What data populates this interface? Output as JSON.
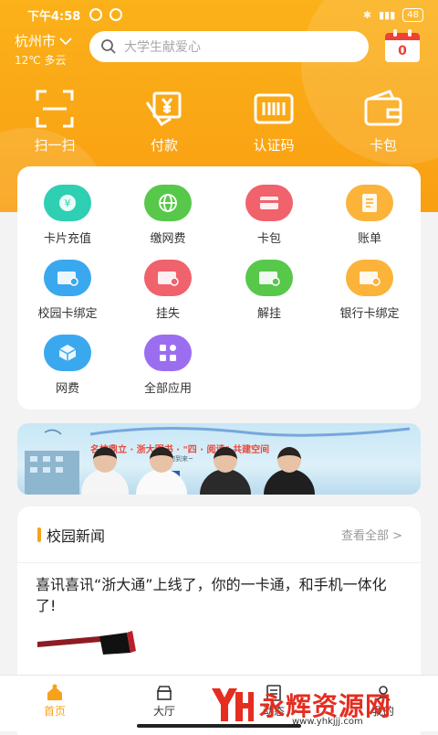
{
  "status": {
    "time": "下午4:58",
    "battery": "48"
  },
  "location": {
    "city": "杭州市",
    "weather": "12℃ 多云"
  },
  "search": {
    "placeholder": "大学生献爱心"
  },
  "calendar": {
    "value": "0"
  },
  "quick_actions": [
    {
      "label": "扫一扫",
      "icon": "scan-icon"
    },
    {
      "label": "付款",
      "icon": "payment-icon"
    },
    {
      "label": "认证码",
      "icon": "barcode-icon"
    },
    {
      "label": "卡包",
      "icon": "wallet-icon"
    }
  ],
  "apps": [
    {
      "label": "卡片充值",
      "icon": "card-recharge-icon",
      "color": "#2ecfb2"
    },
    {
      "label": "缴网费",
      "icon": "globe-icon",
      "color": "#57c84a"
    },
    {
      "label": "卡包",
      "icon": "card-wallet-icon",
      "color": "#f0626c"
    },
    {
      "label": "账单",
      "icon": "bill-icon",
      "color": "#fbb33a"
    },
    {
      "label": "校园卡绑定",
      "icon": "campus-card-bind-icon",
      "color": "#3aa8ef"
    },
    {
      "label": "挂失",
      "icon": "report-loss-icon",
      "color": "#f0626c"
    },
    {
      "label": "解挂",
      "icon": "unfreeze-icon",
      "color": "#57c84a"
    },
    {
      "label": "银行卡绑定",
      "icon": "bank-card-bind-icon",
      "color": "#fbb33a"
    },
    {
      "label": "网费",
      "icon": "net-fee-icon",
      "color": "#3aa8ef"
    },
    {
      "label": "全部应用",
      "icon": "all-apps-icon",
      "color": "#9b6ef0"
    }
  ],
  "banner": {
    "headline": "名校鼎立 · 浙大图书 · \"四 · 阅读\" 共建空间",
    "subline": "期待你的到来~"
  },
  "news": {
    "title": "校园新闻",
    "view_all": "查看全部 >",
    "items": [
      {
        "title": "喜讯喜讯“浙大通”上线了，你的一卡通，和手机一体化了!"
      }
    ]
  },
  "tabbar": [
    {
      "label": "首页",
      "icon": "home-icon",
      "active": true
    },
    {
      "label": "大厅",
      "icon": "hall-icon",
      "active": false
    },
    {
      "label": "动态",
      "icon": "news-icon",
      "active": false
    },
    {
      "label": "我的",
      "icon": "profile-icon",
      "active": false
    }
  ],
  "watermark": {
    "text": "永辉资源网",
    "url": "www.yhkjjj.com"
  },
  "colors": {
    "accent": "#f7a21b",
    "hero": "#fba716"
  }
}
